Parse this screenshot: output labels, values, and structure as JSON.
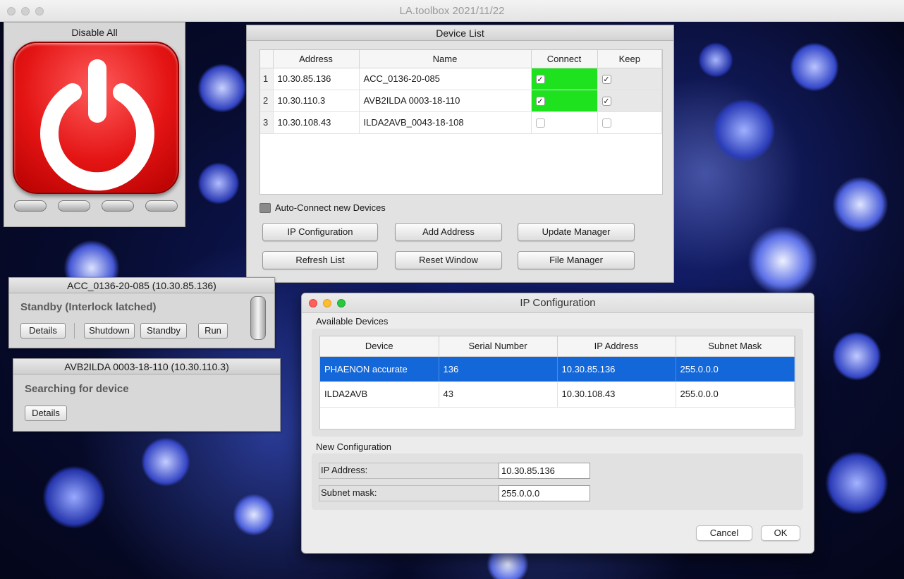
{
  "window": {
    "title": "LA.toolbox 2021/11/22"
  },
  "disable_panel": {
    "title": "Disable All",
    "button_color": "#e41414"
  },
  "device_list": {
    "title": "Device List",
    "columns": [
      "Address",
      "Name",
      "Connect",
      "Keep"
    ],
    "rows": [
      {
        "index": "1",
        "address": "10.30.85.136",
        "name": "ACC_0136-20-085",
        "connect": true,
        "keep": true
      },
      {
        "index": "2",
        "address": "10.30.110.3",
        "name": "AVB2ILDA 0003-18-110",
        "connect": true,
        "keep": true
      },
      {
        "index": "3",
        "address": "10.30.108.43",
        "name": "ILDA2AVB_0043-18-108",
        "connect": false,
        "keep": false
      }
    ],
    "auto_connect_label": "Auto-Connect new Devices",
    "buttons": {
      "ip_config": "IP Configuration",
      "add_address": "Add Address",
      "update_manager": "Update Manager",
      "refresh_list": "Refresh List",
      "reset_window": "Reset Window",
      "file_manager": "File Manager"
    },
    "connect_color": "#1fe21f"
  },
  "status_acc": {
    "title": "ACC_0136-20-085 (10.30.85.136)",
    "status": "Standby (Interlock latched)",
    "buttons": {
      "details": "Details",
      "shutdown": "Shutdown",
      "standby": "Standby",
      "run": "Run"
    }
  },
  "status_avb": {
    "title": "AVB2ILDA 0003-18-110 (10.30.110.3)",
    "status": "Searching for device",
    "buttons": {
      "details": "Details"
    }
  },
  "ip_dialog": {
    "title": "IP Configuration",
    "available_label": "Available Devices",
    "columns": [
      "Device",
      "Serial Number",
      "IP Address",
      "Subnet Mask"
    ],
    "rows": [
      {
        "device": "PHAENON accurate",
        "serial": "136",
        "ip": "10.30.85.136",
        "mask": "255.0.0.0",
        "selected": true
      },
      {
        "device": "ILDA2AVB",
        "serial": "43",
        "ip": "10.30.108.43",
        "mask": "255.0.0.0",
        "selected": false
      }
    ],
    "new_config_label": "New Configuration",
    "ip_label": "IP Address:",
    "ip_value": "10.30.85.136",
    "mask_label": "Subnet mask:",
    "mask_value": "255.0.0.0",
    "cancel_label": "Cancel",
    "ok_label": "OK",
    "selection_color": "#1467d8"
  }
}
